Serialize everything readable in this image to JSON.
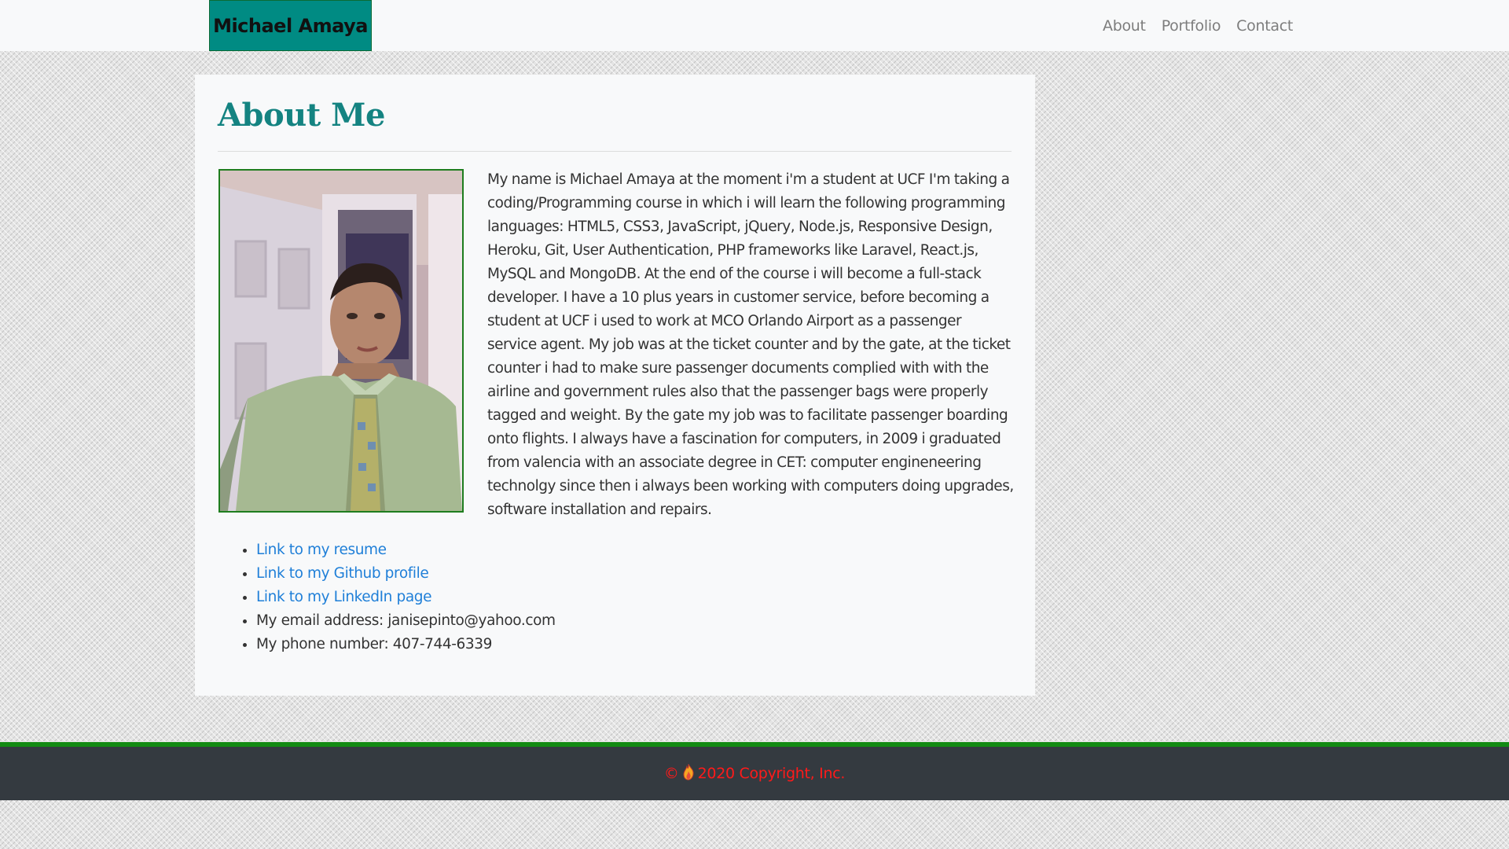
{
  "nav": {
    "brand": "Michael Amaya",
    "links": [
      {
        "label": "About"
      },
      {
        "label": "Portfolio"
      },
      {
        "label": "Contact"
      }
    ]
  },
  "about": {
    "title": "About Me",
    "bio": "My name is Michael Amaya at the moment i'm a student at UCF I'm taking a coding/Programming course in which i will learn the following programming languages: HTML5, CSS3, JavaScript, jQuery, Node.js, Responsive Design, Heroku, Git, User Authentication, PHP frameworks like Laravel, React.js, MySQL and MongoDB. At the end of the course i will become a full-stack developer. I have a 10 plus years in customer service, before becoming a student at UCF i used to work at MCO Orlando Airport as a passenger service agent. My job was at the ticket counter and by the gate, at the ticket counter i had to make sure passenger documents complied with with the airline and government rules also that the passenger bags were properly tagged and weight. By the gate my job was to facilitate passenger boarding onto flights. I always have a fascination for computers, in 2009 i graduated from valencia with an associate degree in CET: computer engineneering technolgy since then i always been working with computers doing upgrades, software installation and repairs.",
    "links": [
      {
        "label": "Link to my resume"
      },
      {
        "label": "Link to my Github profile"
      },
      {
        "label": "Link to my LinkedIn page"
      }
    ],
    "email": "My email address: janisepinto@yahoo.com",
    "phone": "My phone number: 407-744-6339"
  },
  "footer": {
    "copyright_symbol": "©",
    "flame_icon": "flame-icon",
    "copyright_text": "2020 Copyright, Inc."
  },
  "colors": {
    "brand_bg": "#008b83",
    "title": "#148381",
    "link": "#1f7fd8",
    "footer_bg": "#343a40",
    "footer_border": "#138a13",
    "copyright": "#ff1a1a"
  }
}
